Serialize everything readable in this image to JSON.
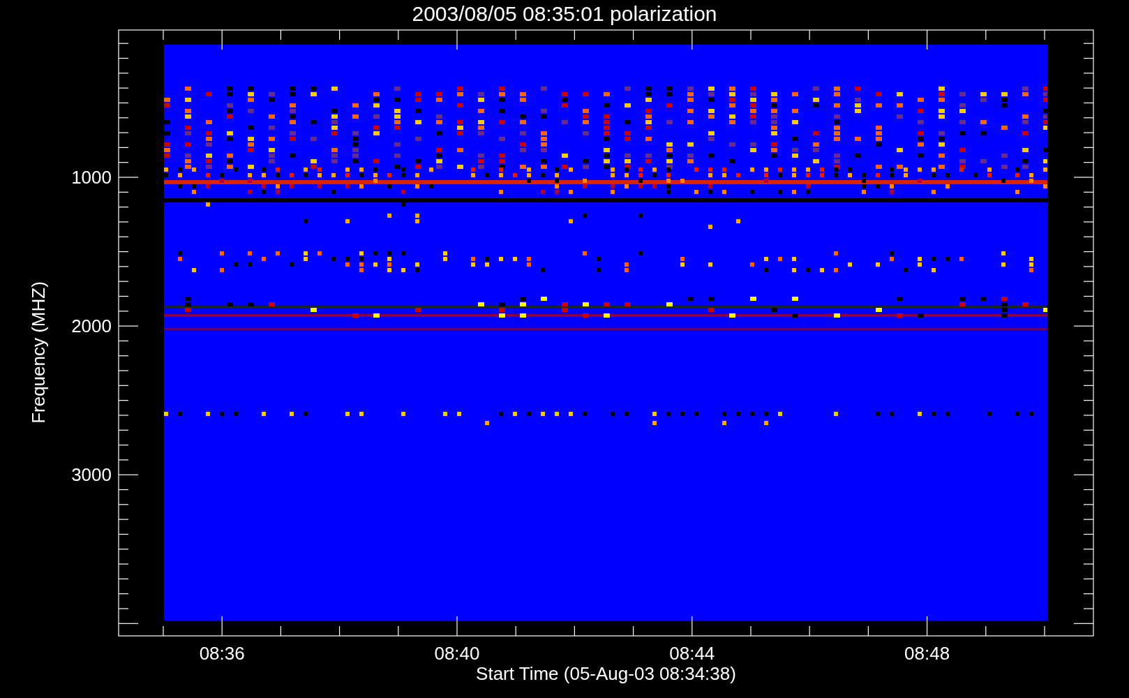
{
  "title": "2003/08/05 08:35:01 polarization",
  "ylabel": "Frequency (MHZ)",
  "xlabel": "Start Time (05-Aug-03 08:34:38)",
  "yticks": [
    "1000",
    "2000",
    "3000"
  ],
  "xticks": [
    "08:36",
    "08:40",
    "08:44",
    "08:48"
  ]
}
